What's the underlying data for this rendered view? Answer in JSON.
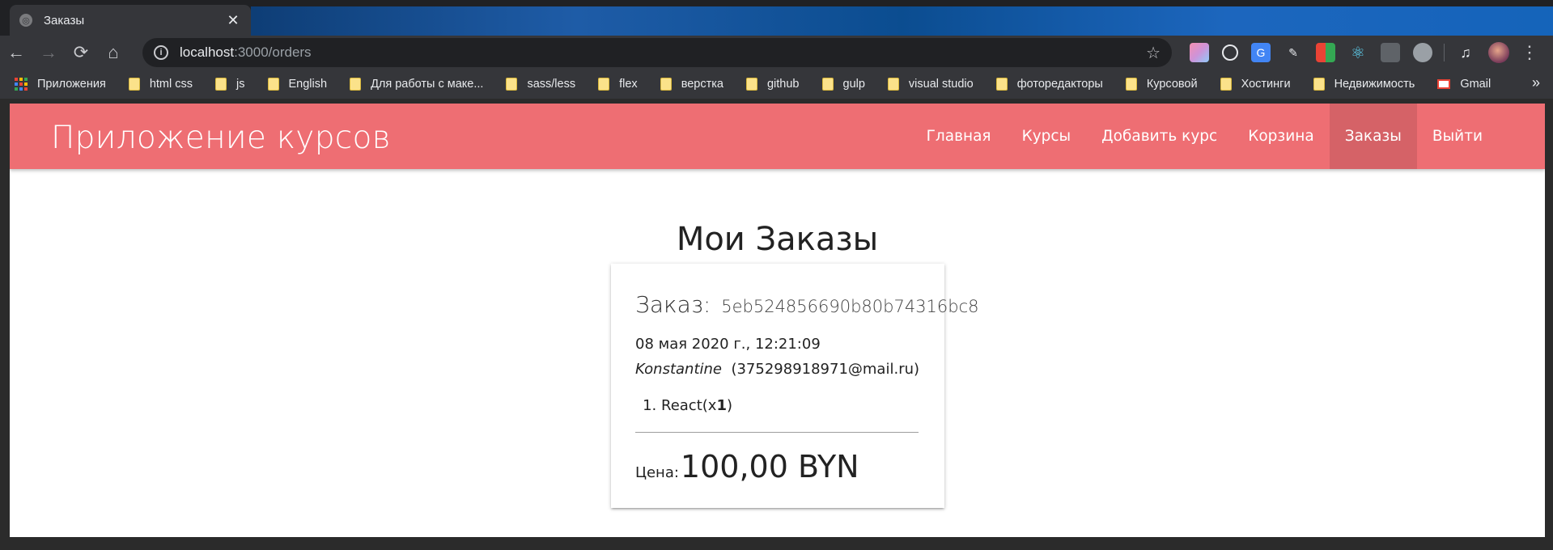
{
  "browser": {
    "tab_title": "Заказы",
    "tab_close": "✕",
    "url_host": "localhost",
    "url_rest": ":3000/orders",
    "bookmarks": [
      {
        "label": "Приложения",
        "type": "apps"
      },
      {
        "label": "html css",
        "type": "folder"
      },
      {
        "label": "js",
        "type": "folder"
      },
      {
        "label": "English",
        "type": "folder"
      },
      {
        "label": "Для работы с маке...",
        "type": "folder"
      },
      {
        "label": "sass/less",
        "type": "folder"
      },
      {
        "label": "flex",
        "type": "folder"
      },
      {
        "label": "верстка",
        "type": "folder"
      },
      {
        "label": "github",
        "type": "folder"
      },
      {
        "label": "gulp",
        "type": "folder"
      },
      {
        "label": "visual studio",
        "type": "folder"
      },
      {
        "label": "фоторедакторы",
        "type": "folder"
      },
      {
        "label": "Курсовой",
        "type": "folder"
      },
      {
        "label": "Хостинги",
        "type": "folder"
      },
      {
        "label": "Недвижимость",
        "type": "folder"
      },
      {
        "label": "Gmail",
        "type": "gmail"
      }
    ],
    "colors": {
      "navbar": "#ee6e73",
      "chrome_dark": "#202124",
      "chrome_toolbar": "#35363a"
    }
  },
  "site": {
    "brand": "Приложение курсов",
    "nav": [
      {
        "label": "Главная",
        "active": false
      },
      {
        "label": "Курсы",
        "active": false
      },
      {
        "label": "Добавить курс",
        "active": false
      },
      {
        "label": "Корзина",
        "active": false
      },
      {
        "label": "Заказы",
        "active": true
      },
      {
        "label": "Выйти",
        "active": false
      }
    ]
  },
  "page": {
    "heading": "Мои Заказы",
    "order": {
      "title_label": "Заказ:",
      "id": "5eb524856690b80b74316bc8",
      "date": "08 мая 2020 г., 12:21:09",
      "user_name": "Konstantine",
      "user_email": "(375298918971@mail.ru)",
      "items": [
        {
          "name": "React",
          "qty": "1"
        }
      ],
      "price_label": "Цена:",
      "price_value": "100,00 BYN"
    }
  }
}
